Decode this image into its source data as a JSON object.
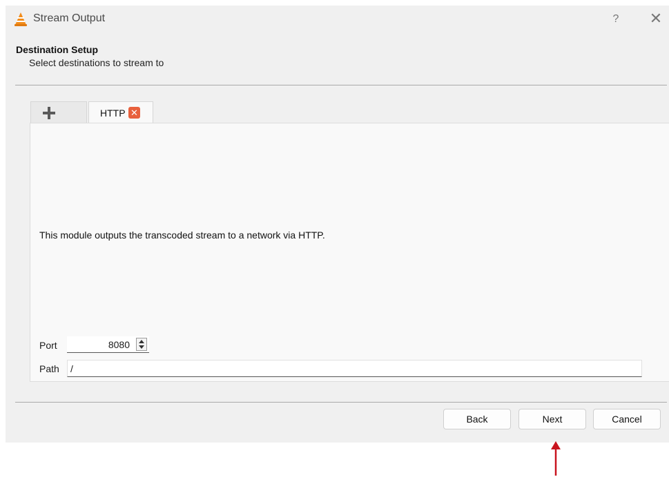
{
  "window": {
    "title": "Stream Output",
    "help_label": "?",
    "close_label": "✕"
  },
  "header": {
    "title": "Destination Setup",
    "subtitle": "Select destinations to stream to"
  },
  "tabs": [
    {
      "label": "+",
      "icon": "plus-icon"
    },
    {
      "label": "HTTP",
      "close_icon": "close-icon"
    }
  ],
  "panel": {
    "description": "This module outputs the transcoded stream to a network via HTTP.",
    "port_label": "Port",
    "port_value": "8080",
    "path_label": "Path",
    "path_value": "/"
  },
  "buttons": {
    "back": "Back",
    "next": "Next",
    "cancel": "Cancel"
  },
  "colors": {
    "accent_close": "#e8603c",
    "vlc_orange": "#f28c1b",
    "annotation_arrow": "#c8141e"
  }
}
